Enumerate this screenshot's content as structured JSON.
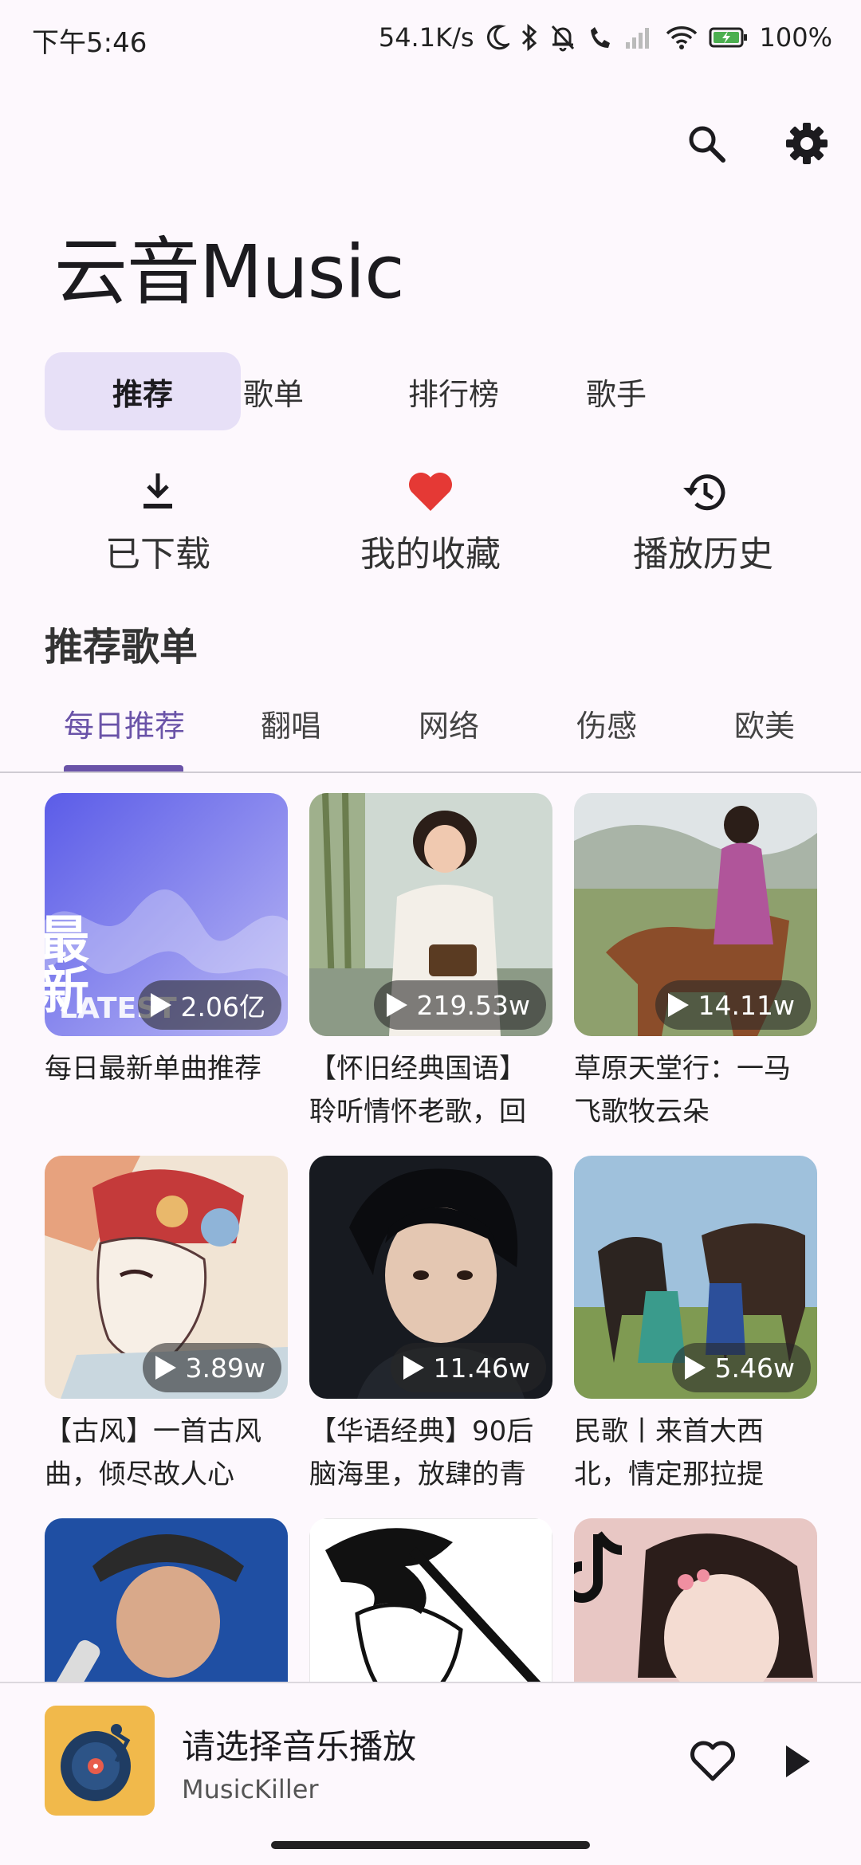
{
  "status_bar": {
    "time": "下午5:46",
    "net_speed": "54.1K/s",
    "battery": "100%"
  },
  "top_actions": {
    "search_icon": "search-icon",
    "settings_icon": "gear-icon"
  },
  "app_title": "云音Music",
  "category_tabs": [
    {
      "label": "推荐",
      "active": true
    },
    {
      "label": "歌单",
      "active": false
    },
    {
      "label": "排行榜",
      "active": false
    },
    {
      "label": "歌手",
      "active": false
    }
  ],
  "quick_actions": [
    {
      "label": "已下载",
      "icon": "download-icon"
    },
    {
      "label": "我的收藏",
      "icon": "heart-icon"
    },
    {
      "label": "播放历史",
      "icon": "history-icon"
    }
  ],
  "section_title": "推荐歌单",
  "sub_tabs": [
    {
      "label": "每日推荐",
      "active": true
    },
    {
      "label": "翻唱",
      "active": false
    },
    {
      "label": "网络",
      "active": false
    },
    {
      "label": "伤感",
      "active": false
    },
    {
      "label": "欧美",
      "active": false
    }
  ],
  "playlists": [
    {
      "title": "每日最新单曲推荐",
      "plays": "2.06亿",
      "cover_text": "最新",
      "cover_sub": "LATEST"
    },
    {
      "title": "【怀旧经典国语】聆听情怀老歌，回",
      "plays": "219.53w"
    },
    {
      "title": "草原天堂行：一马飞歌牧云朵",
      "plays": "14.11w"
    },
    {
      "title": "【古风】一首古风曲，倾尽故人心",
      "plays": "3.89w"
    },
    {
      "title": "【华语经典】90后脑海里，放肆的青",
      "plays": "11.46w"
    },
    {
      "title": "民歌丨来首大西北，情定那拉提",
      "plays": "5.46w"
    },
    {
      "title": "",
      "plays": ""
    },
    {
      "title": "",
      "plays": ""
    },
    {
      "title": "",
      "plays": ""
    }
  ],
  "player": {
    "title": "请选择音乐播放",
    "subtitle": "MusicKiller"
  },
  "colors": {
    "accent": "#6a53a8",
    "tab_active_bg": "#e7e0f7",
    "heart": "#e53935",
    "background": "#fdf8fd"
  }
}
